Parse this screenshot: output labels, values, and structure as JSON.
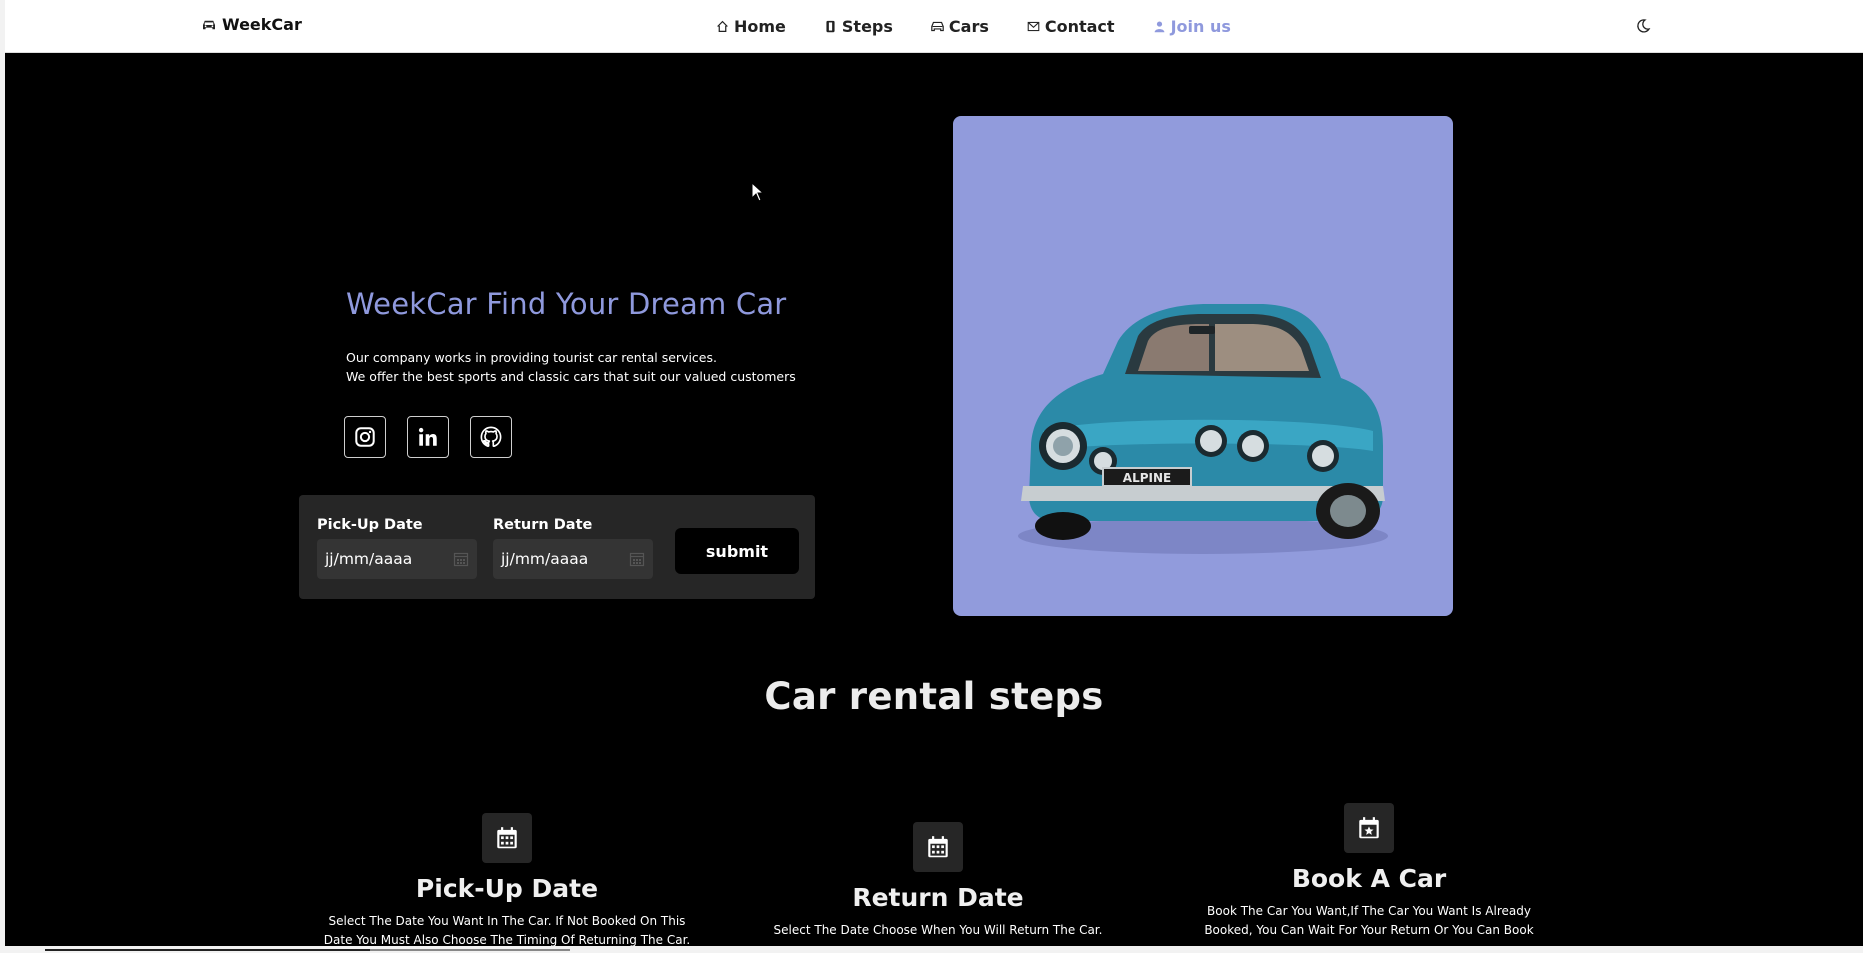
{
  "navbar": {
    "brand": "WeekCar",
    "brand_icon": "car-icon",
    "items": [
      {
        "label": "Home",
        "icon": "home-icon"
      },
      {
        "label": "Steps",
        "icon": "steps-icon"
      },
      {
        "label": "Cars",
        "icon": "car-icon"
      },
      {
        "label": "Contact",
        "icon": "mail-icon"
      },
      {
        "label": "Join us",
        "icon": "user-icon"
      }
    ],
    "theme_toggle_icon": "moon-icon",
    "accent_color": "#8f99dd"
  },
  "hero": {
    "title": "WeekCar Find Your Dream Car",
    "desc_line1": "Our company works in providing tourist car rental services.",
    "desc_line2": "We offer the best sports and classic cars that suit our valued customers",
    "social": [
      "instagram-icon",
      "linkedin-icon",
      "github-icon"
    ],
    "image_bg": "#919bdc"
  },
  "booking": {
    "pickup_label": "Pick-Up Date",
    "pickup_value": "jj/mm/aaaa",
    "return_label": "Return Date",
    "return_value": "jj/mm/aaaa",
    "submit_label": "submit"
  },
  "car_image": {
    "plate_text": "ALPINE"
  },
  "steps_section": {
    "title": "Car rental steps",
    "steps": [
      {
        "icon": "calendar-icon",
        "title": "Pick-Up Date",
        "text1": "Select The Date You Want In The Car. If Not Booked On This",
        "text2": "Date You Must Also Choose The Timing Of Returning The Car."
      },
      {
        "icon": "calendar-icon",
        "title": "Return Date",
        "text1": "Select The Date Choose When You Will Return The Car.",
        "text2": ""
      },
      {
        "icon": "calendar-star-icon",
        "title": "Book A Car",
        "text1": "Book The Car You Want,If The Car You Want Is Already",
        "text2": "Booked, You Can Wait For Your Return Or You Can Book"
      }
    ]
  }
}
